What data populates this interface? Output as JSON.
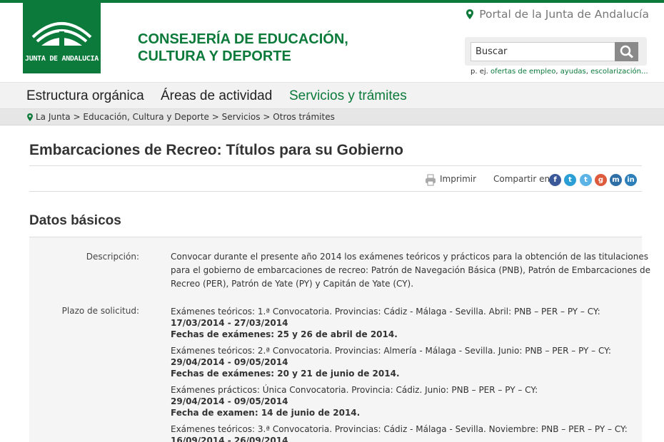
{
  "header": {
    "logo_text": "JUNTA DE ANDALUCIA",
    "consejeria_line1": "CONSEJERÍA DE EDUCACIÓN,",
    "consejeria_line2": "CULTURA Y DEPORTE",
    "portal_link": "Portal de la Junta de Andalucía",
    "search_placeholder": "Buscar",
    "search_hint_prefix": "p. ej.",
    "search_hint_links": [
      "ofertas de empleo",
      "ayudas",
      "escolarización..."
    ],
    "brand_color": "#0b7a3a"
  },
  "nav": {
    "items": [
      {
        "label": "Estructura orgánica",
        "active": false
      },
      {
        "label": "Áreas de actividad",
        "active": false
      },
      {
        "label": "Servicios y trámites",
        "active": true
      }
    ]
  },
  "breadcrumb": {
    "items": [
      "La Junta",
      "Educación, Cultura y Deporte",
      "Servicios",
      "Otros trámites"
    ],
    "separator": ">"
  },
  "page": {
    "title": "Embarcaciones de Recreo: Títulos para su Gobierno",
    "print_label": "Imprimir",
    "share_label": "Compartir en:",
    "share_icons": [
      "facebook-icon",
      "twitter-icon",
      "tuenti-icon",
      "googleplus-icon",
      "meneame-icon",
      "linkedin-icon"
    ]
  },
  "datos": {
    "section_title": "Datos básicos",
    "descripcion_label": "Descripción:",
    "descripcion_lines": [
      "Convocar durante el presente año 2014 los exámenes teóricos y prácticos para la obtención de las titulaciones",
      "para el gobierno de embarcaciones de recreo: Patrón de Navegación Básica (PNB), Patrón de Embarcaciones de",
      "Recreo (PER), Patrón de Yate (PY) y Capitán de Yate (CY)."
    ],
    "plazo_label": "Plazo de solicitud:",
    "convocatorias": [
      {
        "text": "Exámenes teóricos: 1.ª Convocatoria. Provincias: Cádiz - Málaga - Sevilla. Abril: PNB – PER – PY – CY:",
        "dates": "17/03/2014 - 27/03/2014",
        "exam": "Fechas de exámenes: 25 y 26 de abril de 2014."
      },
      {
        "text": "Exámenes teóricos: 2.ª Convocatoria. Provincias: Almería - Málaga - Sevilla. Junio: PNB – PER – PY – CY:",
        "dates": "29/04/2014 - 09/05/2014",
        "exam": "Fechas de exámenes: 20 y 21 de junio de 2014."
      },
      {
        "text": "Exámenes prácticos: Única Convocatoria. Provincia: Cádiz. Junio: PNB – PER – PY – CY:",
        "dates": "29/04/2014 - 09/05/2014",
        "exam": "Fecha de examen: 14 de junio de 2014."
      },
      {
        "text": "Exámenes teóricos: 3.ª Convocatoria. Provincias: Cádiz - Málaga - Sevilla. Noviembre: PNB – PER – PY – CY:",
        "dates": "16/09/2014 - 26/09/2014",
        "exam": ""
      }
    ]
  }
}
